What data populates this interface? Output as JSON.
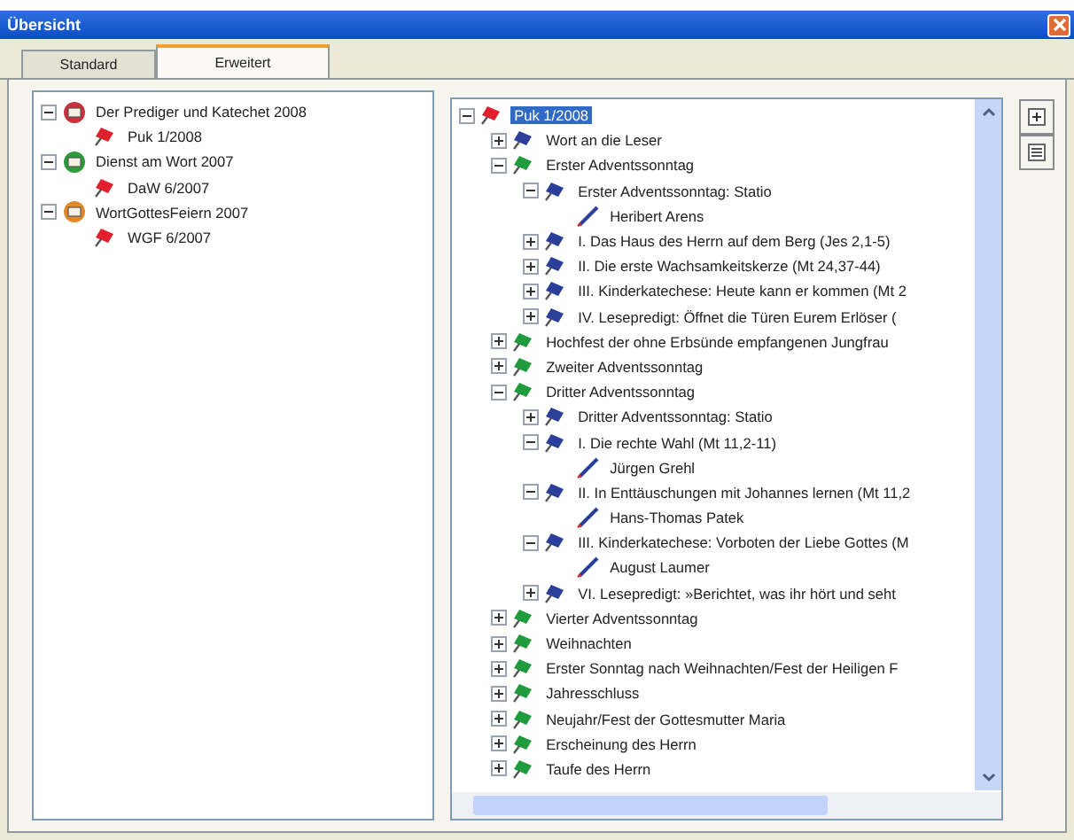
{
  "window": {
    "title": "Übersicht"
  },
  "tabs": [
    {
      "label": "Standard",
      "selected": false
    },
    {
      "label": "Erweitert",
      "selected": true
    }
  ],
  "left_tree": [
    {
      "label": "Der Prediger und Katechet 2008",
      "kind": "series",
      "color": "#c8323c",
      "expanded": true,
      "selected": false,
      "children": [
        {
          "label": "Puk 1/2008",
          "kind": "issue",
          "selected": false
        }
      ]
    },
    {
      "label": "Dienst am Wort 2007",
      "kind": "series",
      "color": "#2e9a3a",
      "expanded": true,
      "selected": false,
      "children": [
        {
          "label": "DaW 6/2007",
          "kind": "issue",
          "selected": false
        }
      ]
    },
    {
      "label": "WortGottesFeiern 2007",
      "kind": "series",
      "color": "#e08a2a",
      "expanded": true,
      "selected": false,
      "children": [
        {
          "label": "WGF 6/2007",
          "kind": "issue",
          "selected": false
        }
      ]
    }
  ],
  "right_tree": [
    {
      "label": "Puk 1/2008",
      "kind": "issue",
      "expanded": true,
      "selected": true,
      "children": [
        {
          "label": "Wort an die Leser",
          "kind": "article",
          "expanded": false,
          "selected": false
        },
        {
          "label": "Erster Adventssonntag",
          "kind": "sunday",
          "expanded": true,
          "selected": false,
          "children": [
            {
              "label": "Erster Adventssonntag: Statio",
              "kind": "article",
              "expanded": true,
              "selected": false,
              "children": [
                {
                  "label": "Heribert Arens",
                  "kind": "author",
                  "selected": false
                }
              ]
            },
            {
              "label": "I. Das Haus des Herrn auf dem Berg (Jes 2,1-5)",
              "kind": "article",
              "expanded": false,
              "selected": false
            },
            {
              "label": "II. Die erste Wachsamkeitskerze (Mt 24,37-44)",
              "kind": "article",
              "expanded": false,
              "selected": false
            },
            {
              "label": "III. Kinderkatechese: Heute kann er kommen (Mt 2",
              "kind": "article",
              "expanded": false,
              "selected": false
            },
            {
              "label": "IV. Lesepredigt: Öffnet die Türen Eurem Erlöser (",
              "kind": "article",
              "expanded": false,
              "selected": false
            }
          ]
        },
        {
          "label": "Hochfest der ohne Erbsünde empfangenen Jungfrau",
          "kind": "sunday",
          "expanded": false,
          "selected": false
        },
        {
          "label": "Zweiter Adventssonntag",
          "kind": "sunday",
          "expanded": false,
          "selected": false
        },
        {
          "label": "Dritter Adventssonntag",
          "kind": "sunday",
          "expanded": true,
          "selected": false,
          "children": [
            {
              "label": "Dritter Adventssonntag: Statio",
              "kind": "article",
              "expanded": false,
              "selected": false
            },
            {
              "label": "I. Die rechte Wahl (Mt 11,2-11)",
              "kind": "article",
              "expanded": true,
              "selected": false,
              "children": [
                {
                  "label": "Jürgen Grehl",
                  "kind": "author",
                  "selected": false
                }
              ]
            },
            {
              "label": "II. In Enttäuschungen mit Johannes lernen (Mt 11,2",
              "kind": "article",
              "expanded": true,
              "selected": false,
              "children": [
                {
                  "label": "Hans-Thomas Patek",
                  "kind": "author",
                  "selected": false
                }
              ]
            },
            {
              "label": "III. Kinderkatechese: Vorboten der Liebe Gottes (M",
              "kind": "article",
              "expanded": true,
              "selected": false,
              "children": [
                {
                  "label": "August Laumer",
                  "kind": "author",
                  "selected": false
                }
              ]
            },
            {
              "label": "VI. Lesepredigt: »Berichtet, was ihr hört und seht",
              "kind": "article",
              "expanded": false,
              "selected": false
            }
          ]
        },
        {
          "label": "Vierter Adventssonntag",
          "kind": "sunday",
          "expanded": false,
          "selected": false
        },
        {
          "label": "Weihnachten",
          "kind": "sunday",
          "expanded": false,
          "selected": false
        },
        {
          "label": "Erster Sonntag nach Weihnachten/Fest der Heiligen F",
          "kind": "sunday",
          "expanded": false,
          "selected": false
        },
        {
          "label": "Jahresschluss",
          "kind": "sunday",
          "expanded": false,
          "selected": false
        },
        {
          "label": "Neujahr/Fest der Gottesmutter Maria",
          "kind": "sunday",
          "expanded": false,
          "selected": false
        },
        {
          "label": "Erscheinung des Herrn",
          "kind": "sunday",
          "expanded": false,
          "selected": false
        },
        {
          "label": "Taufe des Herrn",
          "kind": "sunday",
          "expanded": false,
          "selected": false
        }
      ]
    }
  ]
}
